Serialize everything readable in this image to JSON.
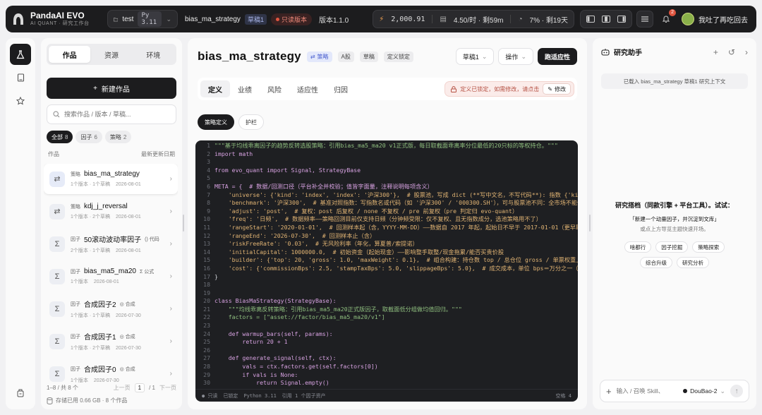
{
  "app": {
    "name": "PandaAI EVO",
    "subtitle": "AI QUANT · 研究工作台"
  },
  "topbar": {
    "workspace": "test",
    "python": "Py 3.11",
    "strategy": "bias_ma_strategy",
    "draft_tag": "草稿1",
    "readonly_label": "只读版本",
    "version": "版本1.1.0",
    "balance": "2,000.91",
    "rate": "4.50/时 · 剩59m",
    "usage": "7% · 剩19天",
    "notifications": "2",
    "user": "我吐了再吃回去"
  },
  "left": {
    "tabs": [
      "作品",
      "资源",
      "环境"
    ],
    "new_button": "新建作品",
    "search_placeholder": "搜索作品 / 版本 / 草稿...",
    "filters": [
      {
        "label": "全部",
        "count": "8"
      },
      {
        "label": "因子",
        "count": "6"
      },
      {
        "label": "策略",
        "count": "2"
      }
    ],
    "list_header": "作品",
    "sort_label": "最新更新日期",
    "items": [
      {
        "kind": "策略",
        "name": "bias_ma_strategy",
        "tag": "",
        "meta": "1个版本 · 1个草稿",
        "date": "2026-08-01",
        "icon": "⇄"
      },
      {
        "kind": "策略",
        "name": "kdj_j_reversal",
        "tag": "",
        "meta": "1个版本 · 2个草稿",
        "date": "2026-08-01",
        "icon": "⇄"
      },
      {
        "kind": "因子",
        "name": "50滚动波动率因子",
        "tag": "() 代码",
        "meta": "2个版本 · 1个草稿",
        "date": "2026-08-01",
        "icon": "Σ"
      },
      {
        "kind": "因子",
        "name": "bias_ma5_ma20",
        "tag": "Σ 公式",
        "meta": "1个版本",
        "date": "2026-08-01",
        "icon": "Σ"
      },
      {
        "kind": "因子",
        "name": "合成因子2",
        "tag": "◎ 合成",
        "meta": "1个版本 · 1个草稿",
        "date": "2026-07-30",
        "icon": "Σ"
      },
      {
        "kind": "因子",
        "name": "合成因子1",
        "tag": "◎ 合成",
        "meta": "1个版本 · 2个草稿",
        "date": "2026-07-30",
        "icon": "Σ"
      },
      {
        "kind": "因子",
        "name": "合成因子0",
        "tag": "◎ 合成",
        "meta": "1个版本",
        "date": "2026-07-30",
        "icon": "Σ"
      }
    ],
    "pager_summary": "1–8 / 共 8 个",
    "prev": "上一页",
    "page": "1",
    "pages": "/ 1",
    "next": "下一页",
    "storage": "存储已用 0.66 GB · 8 个作品"
  },
  "main": {
    "title": "bias_ma_strategy",
    "tag_type": "策略",
    "tag_market": "A股",
    "tag_draft": "草稿",
    "tag_locked": "定义锁定",
    "draft_select": "草稿1",
    "ops": "操作",
    "run": "跑适应性",
    "tabs": [
      "定义",
      "业绩",
      "风险",
      "适应性",
      "归因"
    ],
    "locked_msg": "定义已锁定，如需修改，请点击",
    "edit": "修改",
    "subtabs": [
      "策略定义",
      "护栏"
    ],
    "code_lines": [
      "\"\"\"基于均线乖离因子的趋势反转选股策略：引用bias_ma5_ma20 v1正式版，每日取截面乖离率分位最低的20只标的等权持仓。\"\"\"",
      "import math",
      "",
      "from evo_quant import Signal, StrategyBase",
      "",
      "META = {  # 数据/回测口径（平台补全并校验；值皆字面量，注释说明每项含义）",
      "    'universe': {'kind': 'index', 'index': '沪深300'},  # 股票池，写成 dict (**写中文名，不写代码**): 指数 {'kind':'index','index':'沪深300'}",
      "    'benchmark': '沪深300',  # 基准对照指数：写指数名或代码（如 '沪深300' / '000300.SH'），可与股票池不同：全市场不能作基准",
      "    'adjust': 'post',  # 复权：post 后复权 / none 不复权 / pre 前复权（pre 判定归 evo-quant）",
      "    'freq': '日频',  # 数据频率——策略回测目前仅支持日频（分钟频受限：仅不复权、且无指数成分，选池策略用不了）",
      "    'rangeStart': '2020-01-01',  # 回测样本起（含，YYYY-MM-DD）——数据自 2017 年起，起始日不早于 2017-01-01（更早取不到数据）",
      "    'rangeEnd': '2026-07-30',  # 回测样本止（含）",
      "    'riskFreeRate': '0.03',  # 无风险利率（年化，算夏普/索提诺）",
      "    'initialCapital': 1000000.0,  # 初始资金（起始现金）——影响整手取整/现金拖累/能否买贵价股",
      "    'builder': {'top': 20, 'gross': 1.0, 'maxWeight': 0.1},  # 组合构建：持仓数 top / 总仓位 gross / 单票权重上限 maxWeight",
      "    'cost': {'commissionBps': 2.5, 'stampTaxBps': 5.0, 'slippageBps': 5.0},  # 成交成本，单位 bps＝万分之一（买卖双边）",
      "}",
      "",
      "",
      "class BiasMaStrategy(StrategyBase):",
      "    \"\"\"均线乖离反转策略：引用bias_ma5_ma20正式版因子，取截面低分组做均值回归。\"\"\"",
      "    factors = [\"asset://factor/bias_ma5_ma20/v1\"]",
      "",
      "    def warmup_bars(self, params):",
      "        return 20 + 1",
      "",
      "    def generate_signal(self, ctx):",
      "        vals = ctx.factors.get(self.factors[0])",
      "        if vals is None:",
      "            return Signal.empty()"
    ],
    "status": [
      "只读",
      "已锁定",
      "Python 3.11",
      "引用 1 个因子资产"
    ],
    "status_right": "空格 4"
  },
  "right": {
    "title": "研究助手",
    "context": "已载入 bias_ma_strategy 草稿1 研究上下文",
    "hint_title": "研究搭档（同款引擎 + 平台工具）。试试：",
    "hint_sub": "「新建一个动量因子，并沉淀到文库」",
    "hint_sub2": "或点上方导览主题快速开场。",
    "suggestions": [
      "啥都行",
      "因子挖掘",
      "策略探索",
      "综合升级",
      "研究分析"
    ],
    "input_placeholder": "输入 / 召唤 Skill、",
    "model": "DouBao-2"
  },
  "colors": {
    "accent_dark": "#1c1c1e",
    "danger": "#e0553f",
    "editor_bg": "#1e1f22"
  }
}
